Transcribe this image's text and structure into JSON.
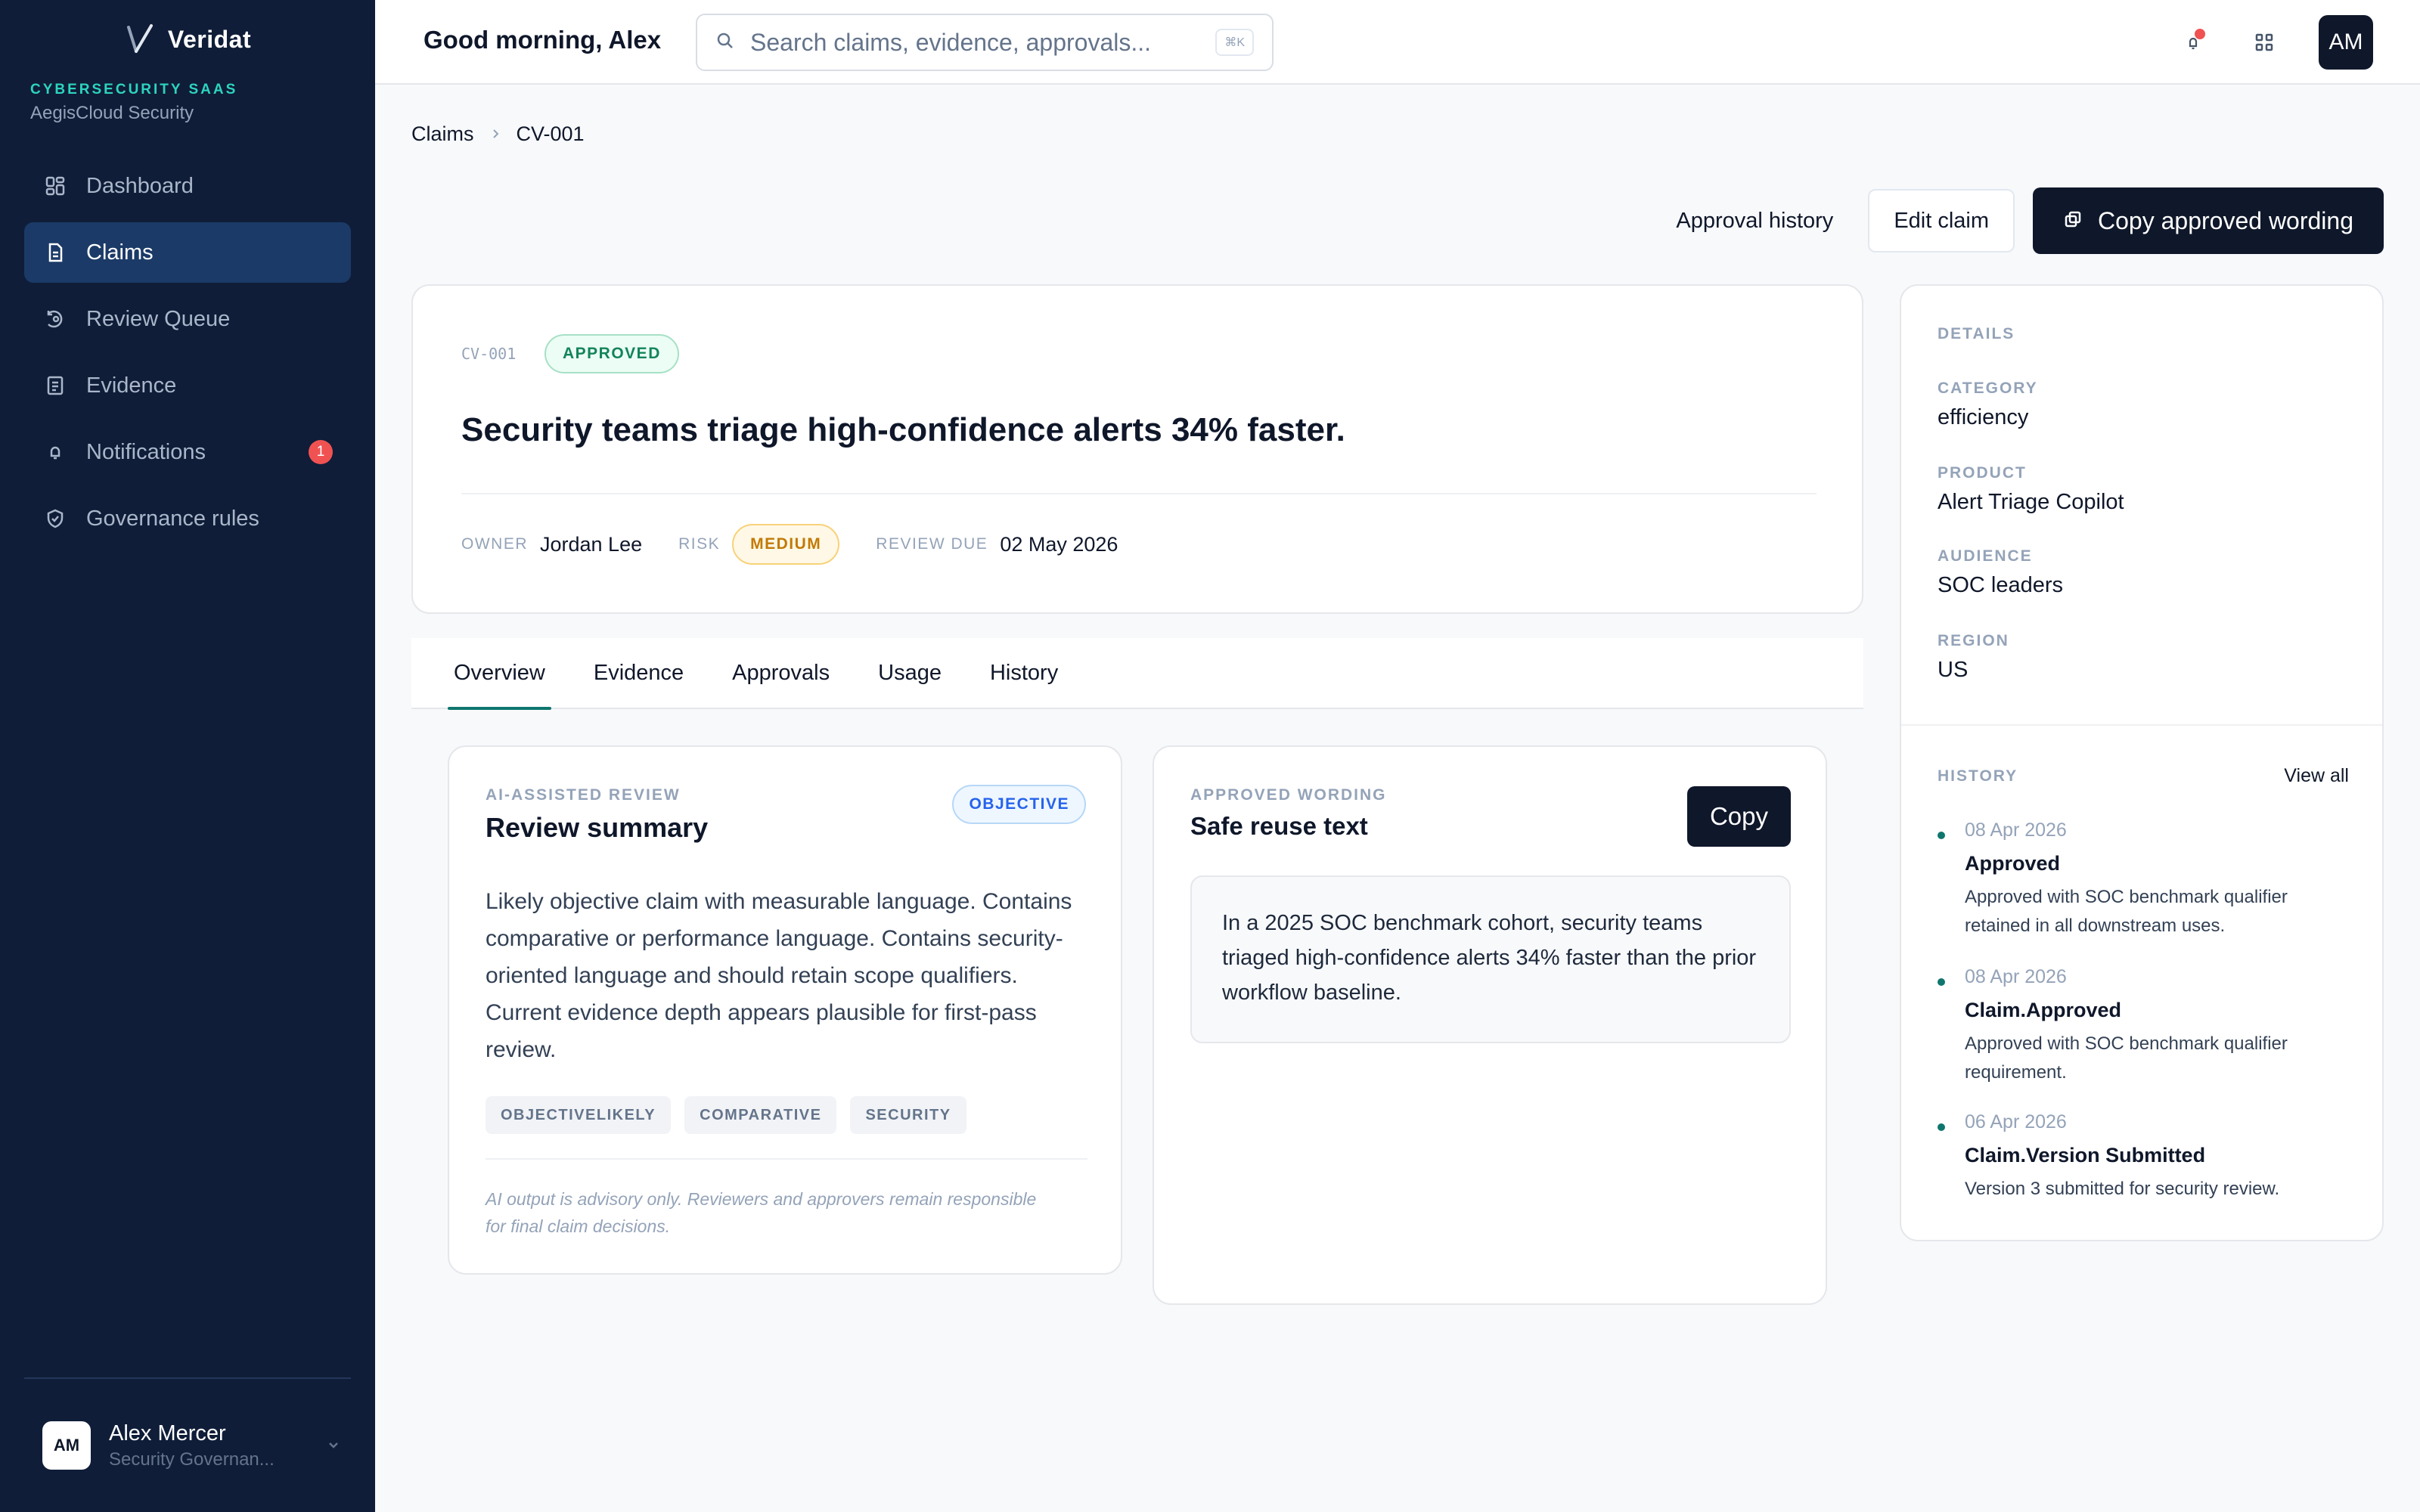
{
  "app": {
    "brand": "Veridat",
    "org_kicker": "CYBERSECURITY SAAS",
    "org_name": "AegisCloud Security"
  },
  "sidebar": {
    "items": [
      {
        "label": "Dashboard",
        "icon": "grid-icon"
      },
      {
        "label": "Claims",
        "icon": "document-icon",
        "active": true
      },
      {
        "label": "Review Queue",
        "icon": "review-icon"
      },
      {
        "label": "Evidence",
        "icon": "file-list-icon"
      },
      {
        "label": "Notifications",
        "icon": "bell-icon",
        "badge": "1"
      },
      {
        "label": "Governance rules",
        "icon": "shield-icon"
      }
    ],
    "user": {
      "initials": "AM",
      "name": "Alex Mercer",
      "role": "Security Governan..."
    }
  },
  "topbar": {
    "greeting": "Good morning, Alex",
    "search_placeholder": "Search claims, evidence, approvals...",
    "shortcut": "⌘K",
    "avatar_initials": "AM"
  },
  "breadcrumb": {
    "root": "Claims",
    "current": "CV-001"
  },
  "actions": {
    "history": "Approval history",
    "edit": "Edit claim",
    "copy": "Copy approved wording"
  },
  "claim": {
    "id": "CV-001",
    "status": "APPROVED",
    "title": "Security teams triage high-confidence alerts 34% faster.",
    "owner_label": "OWNER",
    "owner": "Jordan Lee",
    "risk_label": "RISK",
    "risk": "MEDIUM",
    "due_label": "REVIEW DUE",
    "due": "02 May 2026"
  },
  "tabs": [
    "Overview",
    "Evidence",
    "Approvals",
    "Usage",
    "History"
  ],
  "review": {
    "kicker": "AI-ASSISTED REVIEW",
    "title": "Review summary",
    "badge": "OBJECTIVE",
    "body": "Likely objective claim with measurable language. Contains comparative or performance language. Contains security-oriented language and should retain scope qualifiers. Current evidence depth appears plausible for first-pass review.",
    "tags": [
      "OBJECTIVELIKELY",
      "COMPARATIVE",
      "SECURITY"
    ],
    "disclaimer": "AI output is advisory only. Reviewers and approvers remain responsible for final claim decisions."
  },
  "wording": {
    "kicker": "APPROVED WORDING",
    "title": "Safe reuse text",
    "copy": "Copy",
    "text": "In a 2025 SOC benchmark cohort, security teams triaged high-confidence alerts 34% faster than the prior workflow baseline."
  },
  "details": {
    "kicker": "DETAILS",
    "fields": [
      {
        "label": "CATEGORY",
        "value": "efficiency"
      },
      {
        "label": "PRODUCT",
        "value": "Alert Triage Copilot"
      },
      {
        "label": "AUDIENCE",
        "value": "SOC leaders"
      },
      {
        "label": "REGION",
        "value": "US"
      }
    ],
    "history_kicker": "HISTORY",
    "view_all": "View all",
    "history": [
      {
        "date": "08 Apr 2026",
        "title": "Approved",
        "desc": "Approved with SOC benchmark qualifier retained in all downstream uses."
      },
      {
        "date": "08 Apr 2026",
        "title": "Claim.Approved",
        "desc": "Approved with SOC benchmark qualifier requirement."
      },
      {
        "date": "06 Apr 2026",
        "title": "Claim.Version Submitted",
        "desc": "Version 3 submitted for security review."
      }
    ]
  },
  "colors": {
    "sidebar_bg": "#0f1d38",
    "active_nav": "#1b3a67",
    "accent": "#0f766e",
    "primary_dark": "#0f172a",
    "danger": "#f05252"
  }
}
